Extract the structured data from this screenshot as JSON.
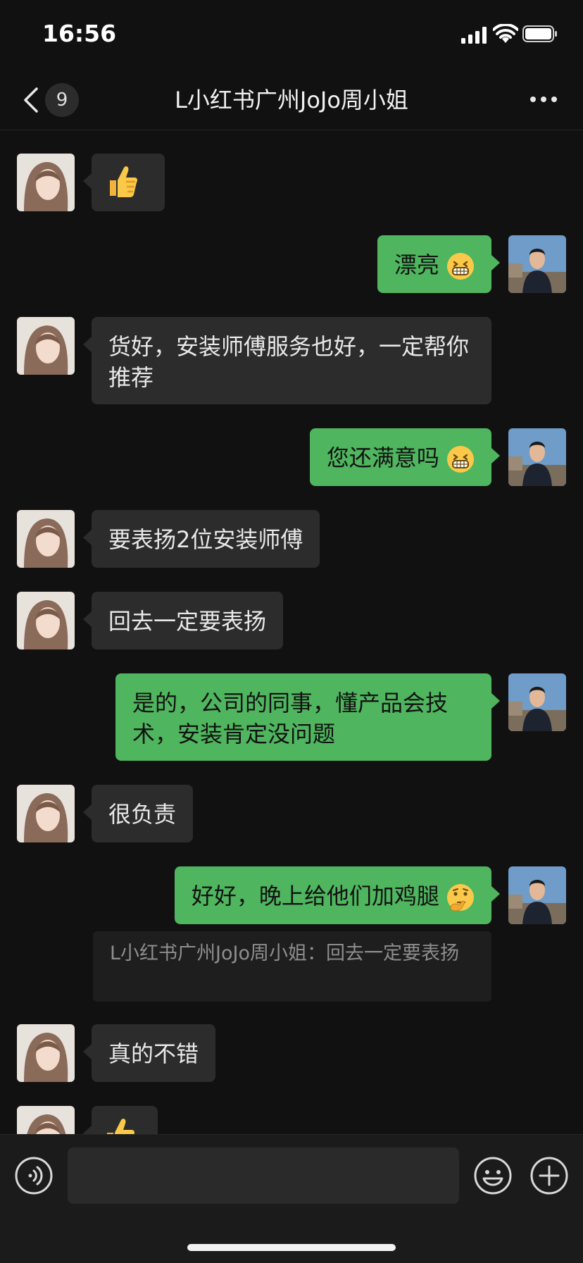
{
  "status_bar": {
    "time": "16:56"
  },
  "header": {
    "unread_count": "9",
    "title": "L小红书广州JoJo周小姐"
  },
  "messages": [
    {
      "side": "in",
      "type": "emoji",
      "icon": "thumbs-up-emoji"
    },
    {
      "side": "out",
      "text": "漂亮",
      "emoji": "grin-emoji"
    },
    {
      "side": "in",
      "text": "货好，安装师傅服务也好，一定帮你推荐"
    },
    {
      "side": "out",
      "text": "您还满意吗",
      "emoji": "grin-emoji"
    },
    {
      "side": "in",
      "text": "要表扬2位安装师傅"
    },
    {
      "side": "in",
      "text": "回去一定要表扬"
    },
    {
      "side": "out",
      "text": "是的，公司的同事，懂产品会技术，安装肯定没问题"
    },
    {
      "side": "in",
      "text": "很负责"
    },
    {
      "side": "out",
      "text": "好好，晚上给他们加鸡腿",
      "emoji": "thinking-emoji"
    },
    {
      "side": "quote",
      "text": "L小红书广州JoJo周小姐：回去一定要表扬"
    },
    {
      "side": "in",
      "text": "真的不错"
    },
    {
      "side": "in",
      "type": "emoji",
      "icon": "thumbs-up-emoji"
    }
  ],
  "colors": {
    "bg": "#111111",
    "incoming_bubble": "#2c2c2c",
    "outgoing_bubble": "#4fb55e",
    "input_bar": "#1b1b1b"
  },
  "input_bar": {
    "icons": [
      "voice-icon",
      "emoji-icon",
      "plus-icon"
    ]
  }
}
